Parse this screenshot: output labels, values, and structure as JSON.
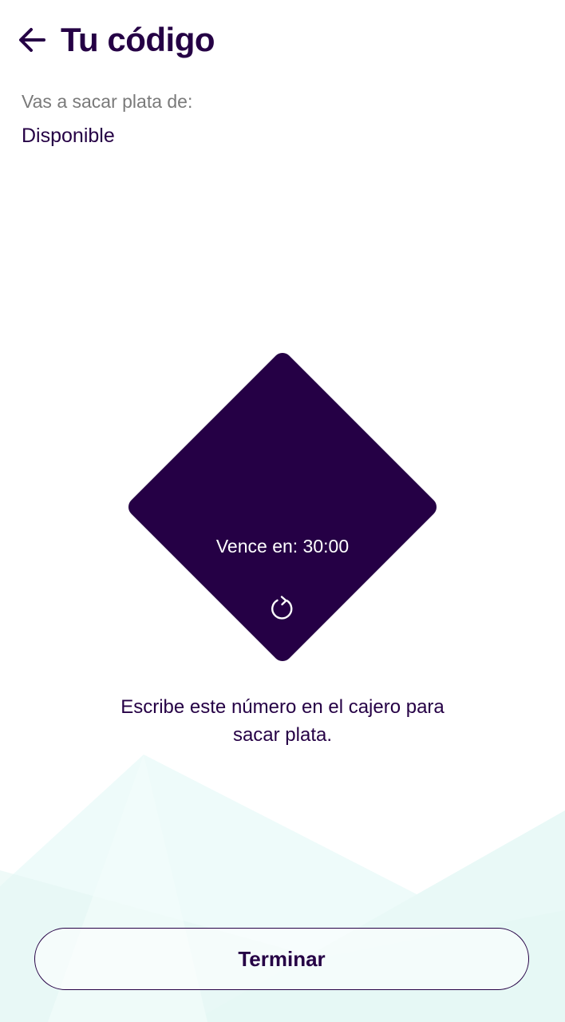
{
  "header": {
    "back_icon": "arrow-left-icon",
    "title": "Tu código"
  },
  "source": {
    "label": "Vas a sacar plata de:",
    "value": "Disponible"
  },
  "code_card": {
    "expiry_text": "Vence en: 30:00",
    "refresh_icon": "refresh-icon"
  },
  "instructions": {
    "line1": "Escribe este número en el cajero para",
    "line2": "sacar plata."
  },
  "actions": {
    "finish_label": "Terminar"
  },
  "colors": {
    "primary": "#250045",
    "muted_text": "#7a7a7a",
    "background": "#ffffff",
    "decor_mint": "#e6f8f6"
  }
}
